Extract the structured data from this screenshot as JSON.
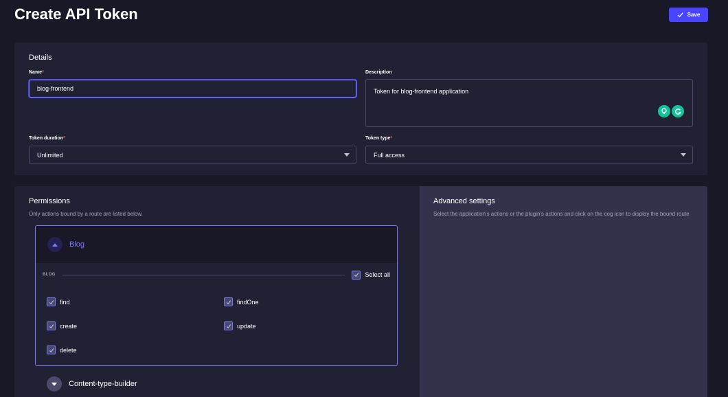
{
  "header": {
    "title": "Create API Token",
    "save_label": "Save"
  },
  "details": {
    "title": "Details",
    "name_label": "Name",
    "name_value": "blog-frontend",
    "description_label": "Description",
    "description_value": "Token for blog-frontend application",
    "duration_label": "Token duration",
    "duration_value": "Unlimited",
    "type_label": "Token type",
    "type_value": "Full access",
    "required_mark": "*"
  },
  "permissions": {
    "title": "Permissions",
    "subtitle": "Only actions bound by a route are listed below.",
    "groups": [
      {
        "title": "Blog",
        "section_label": "BLOG",
        "select_all_label": "Select all",
        "actions": [
          "find",
          "findOne",
          "create",
          "update",
          "delete"
        ]
      },
      {
        "title": "Content-type-builder"
      }
    ]
  },
  "advanced": {
    "title": "Advanced settings",
    "description": "Select the application's actions or the plugin's actions and click on the cog icon to display the bound route"
  },
  "colors": {
    "background": "#181826",
    "card": "#212134",
    "accent": "#4945ff",
    "accent_light": "#7b79ff",
    "advanced_panel": "#32324d",
    "required": "#ee5e52"
  }
}
